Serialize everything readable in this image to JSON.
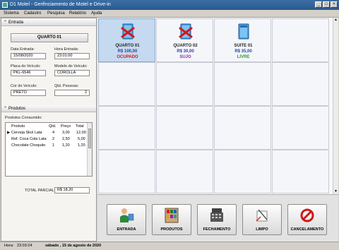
{
  "window": {
    "title": "D1 Motel - Gerênciamento de Motel e Drive-in"
  },
  "menu": [
    "Sistema",
    "Cadastro",
    "Pesquisa",
    "Relatório",
    "Ajuda"
  ],
  "entrada": {
    "section_label": "Entrada",
    "room_button": "QUARTO 01",
    "data_entrada_label": "Data Entrada:",
    "data_entrada": "15/08/2020",
    "hora_entrada_label": "Hora Entrada:",
    "hora_entrada": "23:01:00",
    "placa_label": "Placa do Veículo:",
    "placa": "PKL-6546",
    "modelo_label": "Modelo do Veículo:",
    "modelo": "COROLLA",
    "cor_label": "Cor do Veículo:",
    "cor": "PRETO",
    "qtd_pessoas_label": "Qtd. Pessoas:",
    "qtd_pessoas": "2"
  },
  "produtos": {
    "section_label": "Produtos",
    "consumidos_label": "Produtos Consumido:",
    "columns": [
      "Produto",
      "Qtd.",
      "Preço",
      "Total"
    ],
    "rows": [
      {
        "produto": "Cerveja Skol Lata",
        "qtd": "4",
        "preco": "3,00",
        "total": "12,00",
        "current": true
      },
      {
        "produto": "Ref. Coca Cola Lata",
        "qtd": "2",
        "preco": "2,50",
        "total": "5,00",
        "current": false
      },
      {
        "produto": "Chocolate Choquito",
        "qtd": "1",
        "preco": "1,20",
        "total": "1,20",
        "current": false
      }
    ],
    "total_parcial_label": "TOTAL PARCIAL:",
    "total_parcial": "R$ 18,20"
  },
  "rooms": [
    {
      "name": "QUARTO 01",
      "price": "R$ 100,00",
      "status": "OCUPADO",
      "status_color": "#d01818",
      "icon": "room-occupied-icon",
      "selected": true
    },
    {
      "name": "QUARTO 02",
      "price": "R$ 30,00",
      "status": "SUJO",
      "status_color": "#8a2aa8",
      "icon": "room-dirty-icon",
      "selected": false
    },
    {
      "name": "SUITE 01",
      "price": "R$ 35,00",
      "status": "LIVRE",
      "status_color": "#2a9a2a",
      "icon": "room-free-icon",
      "selected": false
    }
  ],
  "actions": [
    {
      "label": "ENTRADA",
      "icon": "person-entry-icon"
    },
    {
      "label": "PRODUTOS",
      "icon": "products-icon"
    },
    {
      "label": "FECHAMENTO",
      "icon": "cash-register-icon"
    },
    {
      "label": "LIMPO",
      "icon": "cleaning-icon"
    },
    {
      "label": "CANCELAMENTO",
      "icon": "cancel-icon"
    }
  ],
  "status": {
    "hora_label": "Hora:",
    "hora": "23:03:24",
    "date": "sábado ,  15 de agosto de 2020"
  },
  "colors": {
    "title_bar": "#2a5a8f",
    "selected_cell": "#c5d9f0",
    "price": "#2a40a0",
    "cancel_red": "#d01818"
  }
}
